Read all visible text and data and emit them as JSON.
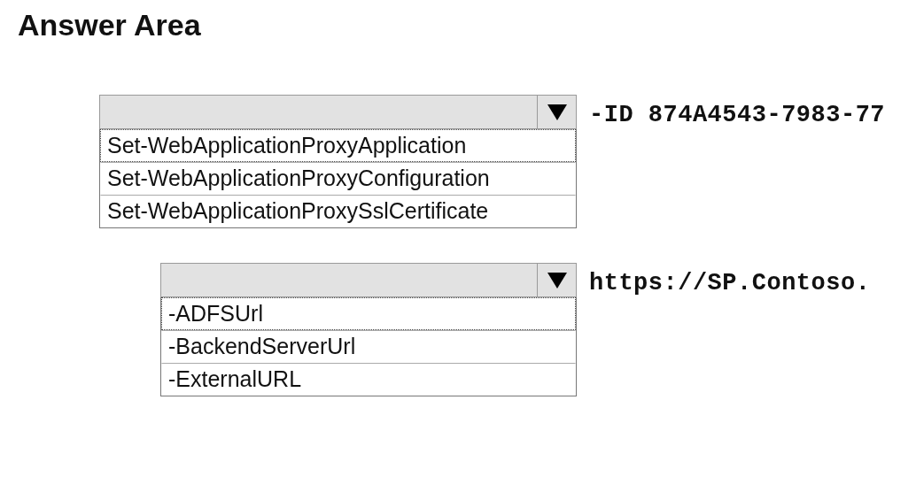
{
  "title": "Answer Area",
  "dropdowns": [
    {
      "options": [
        {
          "label": "Set-WebApplicationProxyApplication",
          "focused": true
        },
        {
          "label": "Set-WebApplicationProxyConfiguration",
          "focused": false
        },
        {
          "label": "Set-WebApplicationProxySslCertificate",
          "focused": false
        }
      ],
      "trailing_text": "-ID 874A4543-7983-77"
    },
    {
      "options": [
        {
          "label": "-ADFSUrl",
          "focused": true
        },
        {
          "label": "-BackendServerUrl",
          "focused": false
        },
        {
          "label": "-ExternalURL",
          "focused": false
        }
      ],
      "trailing_text": "https://SP.Contoso."
    }
  ]
}
